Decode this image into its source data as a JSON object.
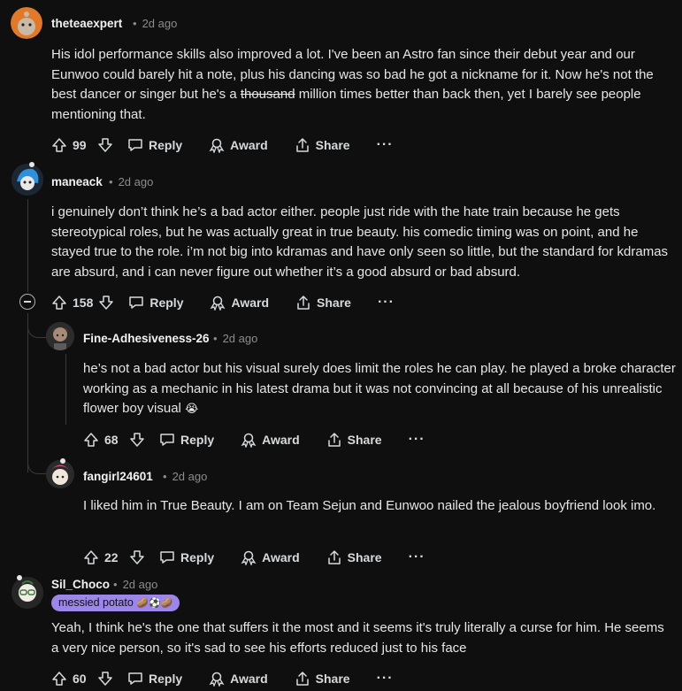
{
  "comments": [
    {
      "username": "theteaexpert",
      "time": "2d ago",
      "text_before": "His idol performance skills also improved a lot. I've been an Astro fan since their debut year and our Eunwoo could barely hit a note, plus his dancing was so bad he got a nickname for it. Now he's not the best dancer or singer but he's a ",
      "text_strike": "thousand",
      "text_after": " million times better than back then, yet I barely see people mentioning that.",
      "votes": "99"
    },
    {
      "username": "maneack",
      "time": "2d ago",
      "text": "i genuinely don’t think he’s a bad actor either. people just ride with the hate train because he gets stereotypical roles, but he was actually great in true beauty. his comedic timing was on point, and he stayed true to the role. i’m not big into kdramas and have only seen so little, but the standard for kdramas are absurd, and i can never figure out whether it’s a good absurd or bad absurd.",
      "votes": "158"
    },
    {
      "username": "Fine-Adhesiveness-26",
      "time": "2d ago",
      "text": "he’s not a bad actor but his visual surely does limit the roles he can play. he played a broke character working as a mechanic in his latest drama but it was not convincing at all because of his unrealistic flower boy visual",
      "emoji": "😭",
      "votes": "68"
    },
    {
      "username": "fangirl24601",
      "time": "2d ago",
      "text": "I liked him in True Beauty. I am on Team Sejun and Eunwoo nailed the jealous boyfriend look imo.",
      "votes": "22"
    },
    {
      "username": "Sil_Choco",
      "time": "2d ago",
      "flair": "messied potato",
      "flair_emojis": "🥔⚽🥔",
      "text": "Yeah, I think he's the one that suffers it the most and it seems it's truly literally a curse for him. He seems a very nice person, so it's sad to see his efforts reduced just to his face",
      "votes": "60"
    }
  ],
  "labels": {
    "reply": "Reply",
    "award": "Award",
    "share": "Share",
    "more": "···",
    "dot": "•"
  },
  "colors": {
    "background": "#0f0f0f",
    "flair": "#9d86e9",
    "thread_line": "#3a3a3a"
  }
}
